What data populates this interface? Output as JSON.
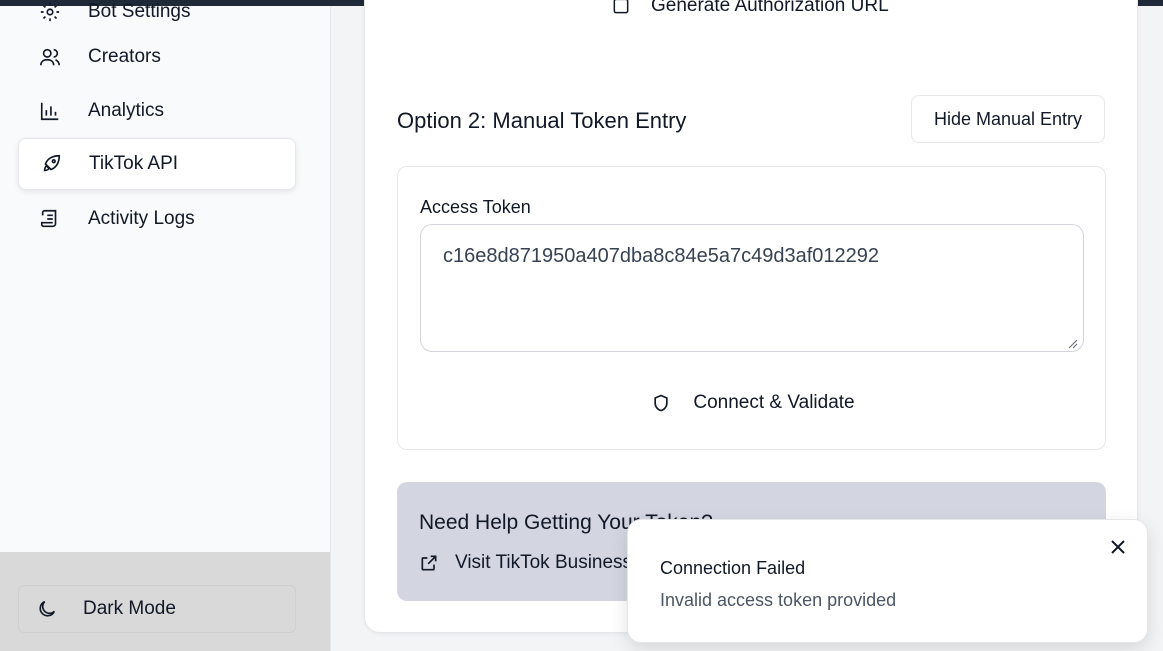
{
  "sidebar": {
    "items": [
      {
        "label": "Bot Settings",
        "icon": "gear-icon"
      },
      {
        "label": "Creators",
        "icon": "users-icon"
      },
      {
        "label": "Analytics",
        "icon": "bar-chart-icon"
      },
      {
        "label": "TikTok API",
        "icon": "rocket-icon",
        "active": true
      },
      {
        "label": "Activity Logs",
        "icon": "scroll-icon"
      }
    ],
    "dark_mode_label": "Dark Mode"
  },
  "main": {
    "generate_url_label": "Generate Authorization URL",
    "option_title": "Option 2: Manual Token Entry",
    "hide_button_label": "Hide Manual Entry",
    "token": {
      "label": "Access Token",
      "value": "c16e8d871950a407dba8c84e5a7c49d3af012292"
    },
    "connect_button_label": "Connect & Validate",
    "help": {
      "title": "Need Help Getting Your Token?",
      "link_label": "Visit TikTok Business"
    }
  },
  "toast": {
    "title": "Connection Failed",
    "message": "Invalid access token provided"
  },
  "colors": {
    "help_bg": "#d3d6e0",
    "sidebar_footer_bg": "#d9d9d9",
    "topbar": "#1f2937"
  }
}
